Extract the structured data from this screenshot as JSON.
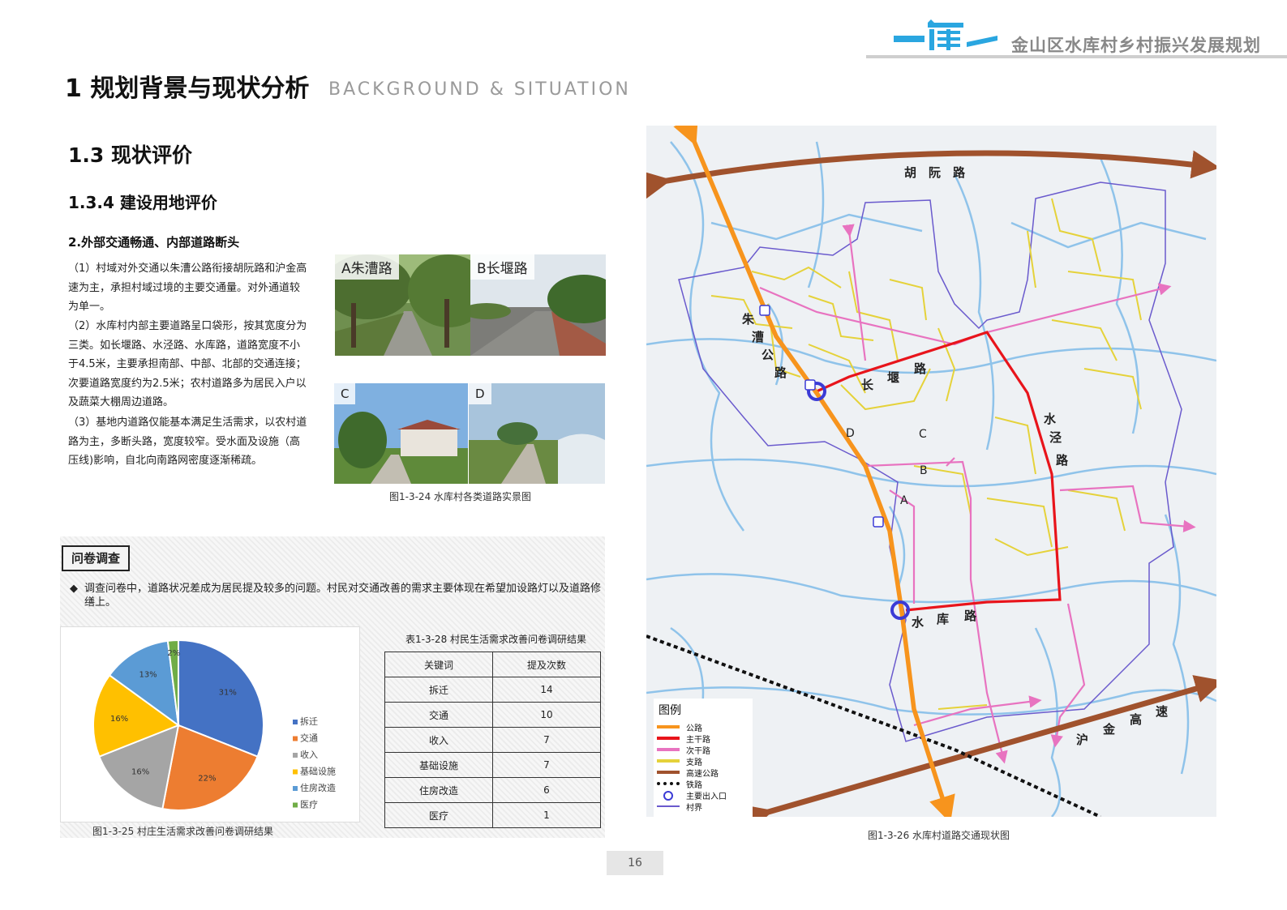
{
  "header": {
    "title": "金山区水库村乡村振兴发展规划"
  },
  "main_title": "1 规划背景与现状分析",
  "main_subtitle": "BACKGROUND & SITUATION",
  "section": "1.3 现状评价",
  "subsection": "1.3.4 建设用地评价",
  "point_title": "2.外部交通畅通、内部道路断头",
  "paragraphs": [
    [
      "（1）村域对外交通以朱漕公路衔接胡阮路和沪金高",
      "速为主，承担村域过境的主要交通量。对外通道较",
      "为单一。"
    ],
    [
      "（2）水库村内部主要道路呈口袋形，按其宽度分为",
      "三类。如长堰路、水泾路、水库路，道路宽度不小",
      "于4.5米，主要承担南部、中部、北部的交通连接；",
      "次要道路宽度约为2.5米；农村道路多为居民入户以",
      "及蔬菜大棚周边道路。"
    ],
    [
      "（3）基地内道路仅能基本满足生活需求，以农村道",
      "路为主，多断头路，宽度较窄。受水面及设施（高",
      "压线)影响，自北向南路网密度逐渐稀疏。"
    ]
  ],
  "photos": [
    {
      "label": "A朱漕路"
    },
    {
      "label": "B长堰路"
    },
    {
      "label": "C"
    },
    {
      "label": "D"
    }
  ],
  "photo_caption": "图1-3-24 水库村各类道路实景图",
  "survey": {
    "tag": "问卷调查",
    "bullet": "◆",
    "text": "调查问卷中，道路状况差成为居民提及较多的问题。村民对交通改善的需求主要体现在希望加设路灯以及道路修缮上。",
    "chart_caption": "图1-3-25 村庄生活需求改善问卷调研结果",
    "table_title": "表1-3-28 村民生活需求改善问卷调研结果",
    "table_headers": [
      "关键词",
      "提及次数"
    ],
    "table_rows": [
      [
        "拆迁",
        "14"
      ],
      [
        "交通",
        "10"
      ],
      [
        "收入",
        "7"
      ],
      [
        "基础设施",
        "7"
      ],
      [
        "住房改造",
        "6"
      ],
      [
        "医疗",
        "1"
      ]
    ]
  },
  "chart_data": {
    "type": "pie",
    "categories": [
      "拆迁",
      "交通",
      "收入",
      "基础设施",
      "住房改造",
      "医疗"
    ],
    "values": [
      31,
      22,
      16,
      16,
      13,
      2
    ],
    "labels": [
      "31%",
      "22%",
      "16%",
      "16%",
      "13%",
      "2%"
    ],
    "colors": [
      "#4472C4",
      "#ED7D31",
      "#A5A5A5",
      "#FFC000",
      "#5B9BD5",
      "#70AD47"
    ],
    "legend_position": "right"
  },
  "map": {
    "caption": "图1-3-26 水库村道路交通现状图",
    "road_labels": {
      "hu_ruan": "胡　阮　路",
      "zhu_cao": [
        "朱",
        "漕",
        "公",
        "路"
      ],
      "chang_yan": [
        "长",
        "堰",
        "路"
      ],
      "shui_jing": [
        "水",
        "泾",
        "路"
      ],
      "shui_ku": [
        "水",
        "库",
        "路"
      ],
      "hu_jin": [
        "沪",
        "金",
        "高",
        "速"
      ]
    },
    "point_labels": [
      "A",
      "B",
      "C",
      "D"
    ],
    "legend_title": "图例",
    "legend": [
      {
        "label": "公路",
        "color": "#F7941D"
      },
      {
        "label": "主干路",
        "color": "#E8141B"
      },
      {
        "label": "次干路",
        "color": "#E873C0"
      },
      {
        "label": "支路",
        "color": "#E5D23A"
      },
      {
        "label": "高速公路",
        "color": "#A0522D"
      },
      {
        "label": "铁路",
        "color": "#111111"
      },
      {
        "label": "主要出入口",
        "color": "#3B3BD6"
      },
      {
        "label": "村界",
        "color": "#6A5ACD"
      }
    ]
  },
  "page_number": "16"
}
